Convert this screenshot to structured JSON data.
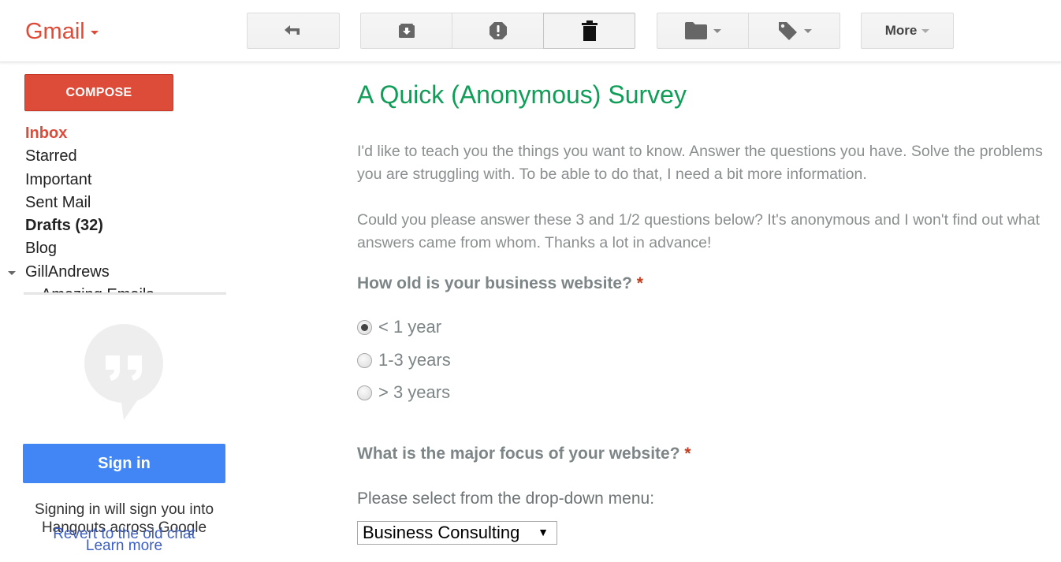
{
  "header": {
    "brand": "Gmail",
    "toolbar": {
      "back": {
        "icon": "back-arrow-icon",
        "label": "Back"
      },
      "archive": {
        "icon": "archive-icon",
        "label": "Archive"
      },
      "spam": {
        "icon": "report-spam-icon",
        "label": "Report spam"
      },
      "delete": {
        "icon": "trash-icon",
        "label": "Delete"
      },
      "move_to": {
        "icon": "folder-icon",
        "label": "Move to"
      },
      "labels": {
        "icon": "label-tag-icon",
        "label": "Labels"
      },
      "more_label": "More"
    }
  },
  "sidebar": {
    "compose_label": "COMPOSE",
    "items": [
      {
        "label": "Inbox",
        "state": "active"
      },
      {
        "label": "Starred"
      },
      {
        "label": "Important"
      },
      {
        "label": "Sent Mail"
      },
      {
        "label": "Drafts (32)",
        "state": "bold"
      },
      {
        "label": "Blog"
      },
      {
        "label": "GillAndrews",
        "expanded": true
      },
      {
        "label": "Amazing Emails",
        "child": true
      }
    ],
    "hangouts": {
      "icon": "hangouts-quote-icon",
      "signin_label": "Sign in",
      "info_text": "Signing in will sign you into Hangouts across Google",
      "revert_link": "Revert to the old chat",
      "learn_more_link": "Learn more"
    }
  },
  "email": {
    "title": "A Quick (Anonymous) Survey",
    "paragraphs": [
      "I'd like to teach you the things you want to know. Answer the questions you have. Solve the problems you are struggling with. To be able to do that, I need a bit more information.",
      "Could you please answer these 3 and 1/2 questions below? It's anonymous and I won't find out what answers came from whom. Thanks a lot in advance!"
    ],
    "questions": [
      {
        "text": "How old is your business website?",
        "required_mark": "*",
        "type": "radio",
        "options": [
          "< 1 year",
          "1-3 years",
          "> 3 years"
        ],
        "selected": "< 1 year"
      },
      {
        "text": "What is the major focus of your website?",
        "required_mark": "*",
        "type": "select",
        "hint": "Please select from the drop-down menu:",
        "selected": "Business Consulting",
        "arrow": "▼"
      }
    ]
  },
  "colors": {
    "brand_red": "#dd4b39",
    "title_green": "#0f9d58",
    "signin_blue": "#4285f4",
    "link_blue": "#3c5ec4",
    "required_red": "#c43b1d"
  }
}
